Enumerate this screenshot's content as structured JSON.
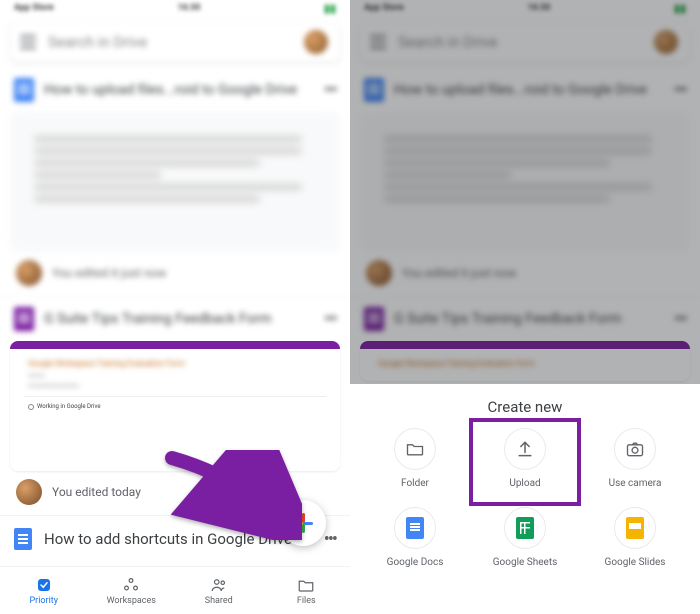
{
  "status": {
    "left": "App Store",
    "time": "16:30"
  },
  "search": {
    "placeholder": "Search in Drive"
  },
  "file1": {
    "title": "How to upload files...roid to Google Drive"
  },
  "file2": {
    "title": "G Suite Tips Training Feedback Form",
    "heading": "Google Workspace Training Evaluation Form",
    "radio_label": "Working in Google Drive"
  },
  "edited_blur": "You edited it just now",
  "edited": "You edited today",
  "list_item": "How to add shortcuts in Google Drive",
  "nav": {
    "priority": "Priority",
    "workspaces": "Workspaces",
    "shared": "Shared",
    "files": "Files"
  },
  "sheet": {
    "title": "Create new",
    "items": {
      "folder": "Folder",
      "upload": "Upload",
      "camera": "Use camera",
      "docs": "Google Docs",
      "sheets": "Google Sheets",
      "slides": "Google Slides"
    }
  }
}
